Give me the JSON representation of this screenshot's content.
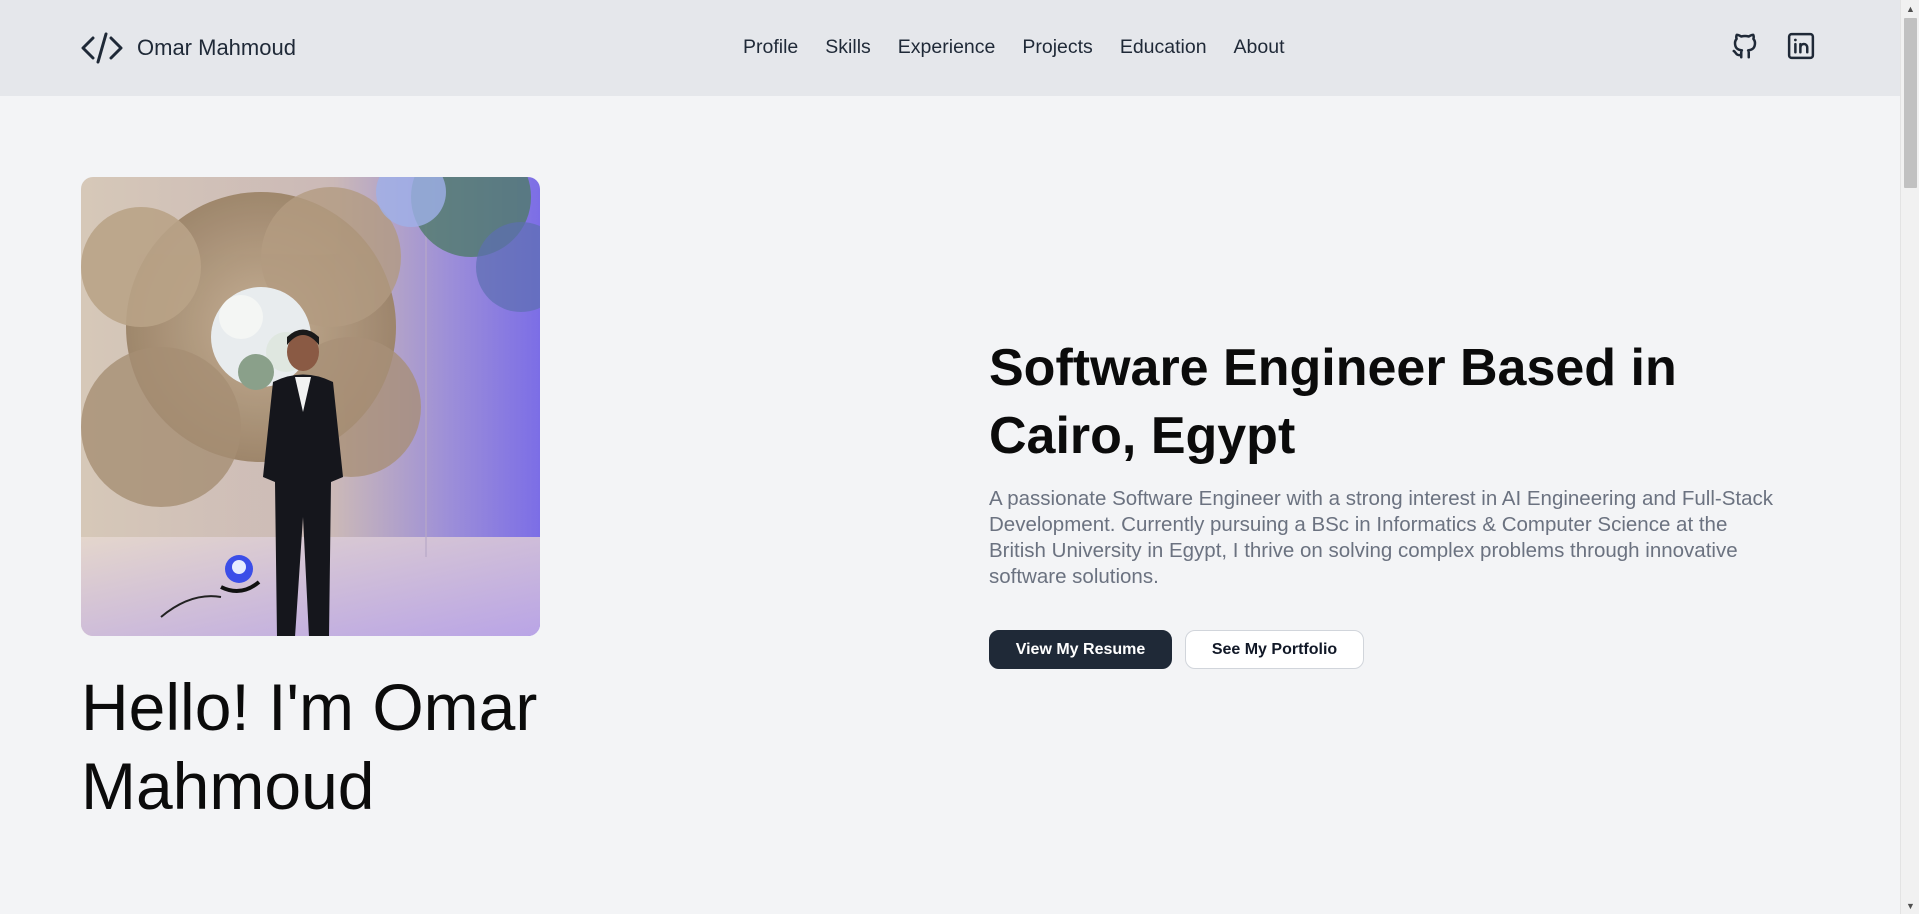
{
  "header": {
    "brand_name": "Omar Mahmoud",
    "brand_icon": "code-icon",
    "nav": [
      {
        "label": "Profile"
      },
      {
        "label": "Skills"
      },
      {
        "label": "Experience"
      },
      {
        "label": "Projects"
      },
      {
        "label": "Education"
      },
      {
        "label": "About"
      }
    ],
    "social": [
      {
        "icon": "github-icon"
      },
      {
        "icon": "linkedin-icon"
      }
    ]
  },
  "hero": {
    "greeting": "Hello! I'm Omar Mahmoud",
    "headline": "Software Engineer Based in Cairo, Egypt",
    "intro": "A passionate Software Engineer with a strong interest in AI Engineering and Full-Stack Development. Currently pursuing a BSc in Informatics & Computer Science at the British University in Egypt, I thrive on solving complex problems through innovative software solutions.",
    "primary_button": "View My Resume",
    "secondary_button": "See My Portfolio"
  },
  "colors": {
    "header_bg": "#e5e7eb",
    "page_bg": "#f3f4f6",
    "primary_button_bg": "#1f2937",
    "body_text_muted": "#6b7280"
  }
}
